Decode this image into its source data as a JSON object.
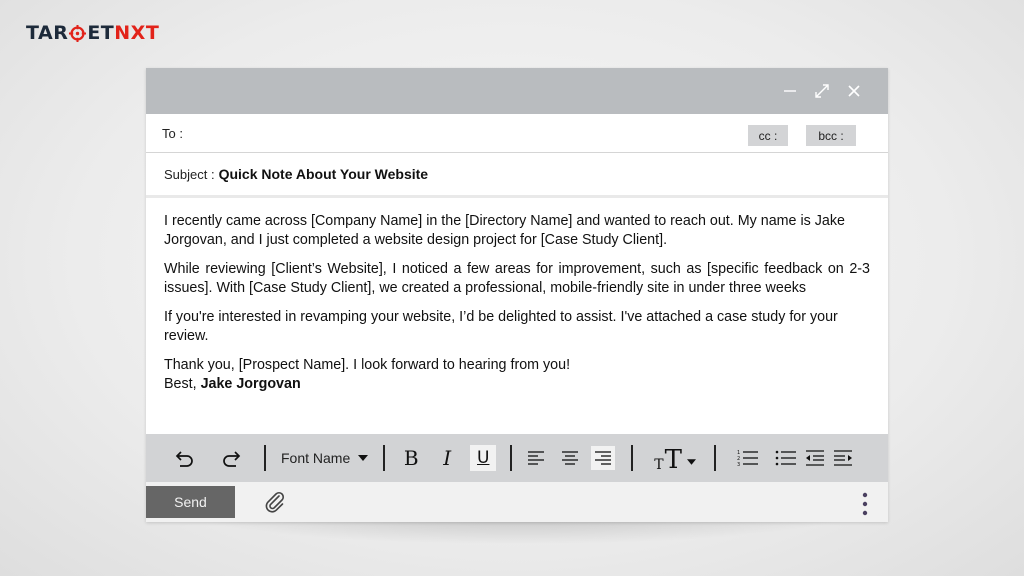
{
  "logo": {
    "part1": "TAR",
    "part2": "ET",
    "part3": "NXT"
  },
  "colors": {
    "brand_red": "#e2231a",
    "brand_dark": "#1d2a3a",
    "titlebar": "#b9bcbf",
    "toolbar": "#d2d3d5",
    "send_button": "#666666"
  },
  "window": {
    "controls": {
      "minimize": "minimize-icon",
      "maximize": "expand-icon",
      "close": "close-icon"
    }
  },
  "to": {
    "label": "To :",
    "cc_label": "cc :",
    "bcc_label": "bcc :"
  },
  "subject": {
    "label": "Subject :",
    "value": "Quick Note About Your Website"
  },
  "body": {
    "p1": "I recently came across [Company Name] in the [Directory Name] and wanted to reach out. My name is Jake Jorgovan, and I just completed a website design project for [Case Study Client].",
    "p2": "While reviewing [Client’s Website], I noticed a few areas for improvement, such as [specific feedback on 2-3 issues]. With [Case Study Client], we created a professional, mobile-friendly site in under three weeks",
    "p3": "If you're interested in revamping your website, I’d be delighted to assist. I've attached a case study for your review.",
    "p4": "Thank you, [Prospect Name]. I look forward to hearing from you!",
    "closing": "Best, ",
    "signature": "Jake Jorgovan"
  },
  "toolbar": {
    "font_name": "Font Name",
    "bold": "B",
    "italic": "I",
    "underline": "U",
    "text_size_small": "T",
    "text_size_large": "T",
    "icons": [
      "undo-icon",
      "redo-icon",
      "align-left-icon",
      "align-center-icon",
      "align-right-icon",
      "text-size-icon",
      "numbered-list-icon",
      "bulleted-list-icon",
      "indent-decrease-icon",
      "indent-increase-icon"
    ]
  },
  "sendbar": {
    "send_label": "Send",
    "icons": [
      "paperclip-icon",
      "more-vertical-icon"
    ]
  }
}
